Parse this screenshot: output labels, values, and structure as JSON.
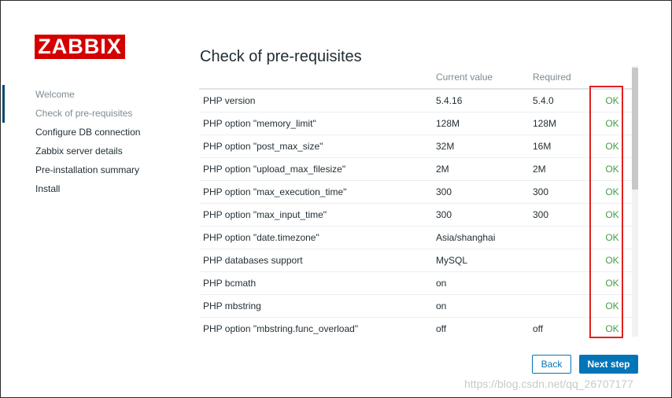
{
  "logo": "ZABBIX",
  "nav": {
    "items": [
      {
        "label": "Welcome"
      },
      {
        "label": "Check of pre-requisites"
      },
      {
        "label": "Configure DB connection"
      },
      {
        "label": "Zabbix server details"
      },
      {
        "label": "Pre-installation summary"
      },
      {
        "label": "Install"
      }
    ]
  },
  "page": {
    "title": "Check of pre-requisites"
  },
  "table": {
    "headers": [
      "",
      "Current value",
      "Required",
      ""
    ],
    "rows": [
      {
        "name": "PHP version",
        "current": "5.4.16",
        "required": "5.4.0",
        "result": "OK"
      },
      {
        "name": "PHP option \"memory_limit\"",
        "current": "128M",
        "required": "128M",
        "result": "OK"
      },
      {
        "name": "PHP option \"post_max_size\"",
        "current": "32M",
        "required": "16M",
        "result": "OK"
      },
      {
        "name": "PHP option \"upload_max_filesize\"",
        "current": "2M",
        "required": "2M",
        "result": "OK"
      },
      {
        "name": "PHP option \"max_execution_time\"",
        "current": "300",
        "required": "300",
        "result": "OK"
      },
      {
        "name": "PHP option \"max_input_time\"",
        "current": "300",
        "required": "300",
        "result": "OK"
      },
      {
        "name": "PHP option \"date.timezone\"",
        "current": "Asia/shanghai",
        "required": "",
        "result": "OK"
      },
      {
        "name": "PHP databases support",
        "current": "MySQL",
        "required": "",
        "result": "OK"
      },
      {
        "name": "PHP bcmath",
        "current": "on",
        "required": "",
        "result": "OK"
      },
      {
        "name": "PHP mbstring",
        "current": "on",
        "required": "",
        "result": "OK"
      },
      {
        "name": "PHP option \"mbstring.func_overload\"",
        "current": "off",
        "required": "off",
        "result": "OK"
      }
    ]
  },
  "buttons": {
    "back": "Back",
    "next": "Next step"
  },
  "watermark": "https://blog.csdn.net/qq_26707177",
  "colors": {
    "brand": "#d40000",
    "ok": "#429e47",
    "primary": "#0275b8",
    "highlight": "#e02020"
  }
}
